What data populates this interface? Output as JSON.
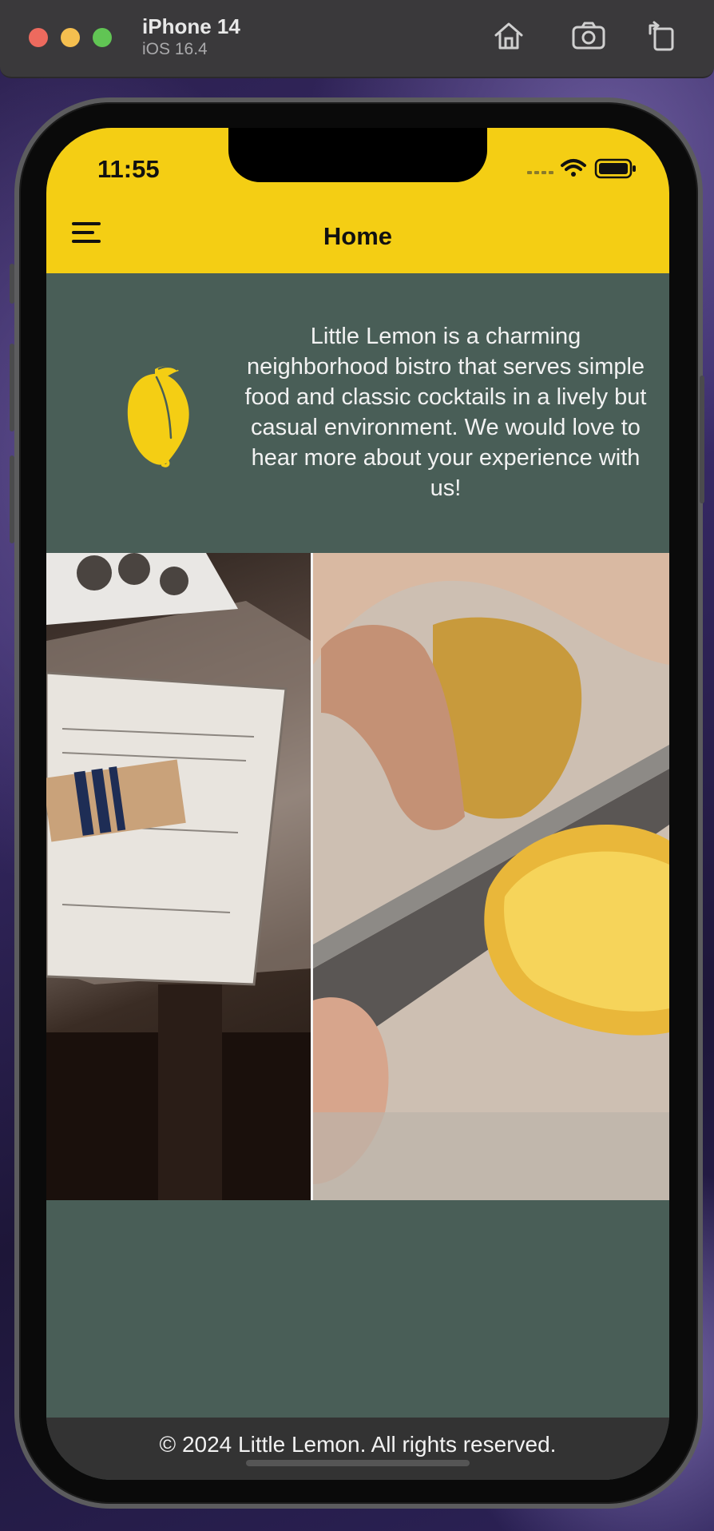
{
  "simulator": {
    "device_name": "iPhone 14",
    "os_version": "iOS 16.4",
    "toolbar_icons": [
      "home-icon",
      "screenshot-icon",
      "rotate-icon"
    ]
  },
  "status_bar": {
    "time": "11:55",
    "icons": [
      "cellular-icon",
      "wifi-icon",
      "battery-icon"
    ]
  },
  "nav": {
    "title": "Home",
    "menu_icon": "hamburger-menu-icon"
  },
  "intro": {
    "logo_icon": "lemon-icon",
    "text": "Little Lemon is a charming neighborhood bistro that serves simple food and classic cocktails in a lively but casual environment. We would love to hear more about your experience with us!"
  },
  "footer": {
    "text": "© 2024 Little Lemon. All rights reserved."
  },
  "colors": {
    "primary_yellow": "#f4ce14",
    "primary_green": "#495e57",
    "footer_dark": "#333333"
  }
}
